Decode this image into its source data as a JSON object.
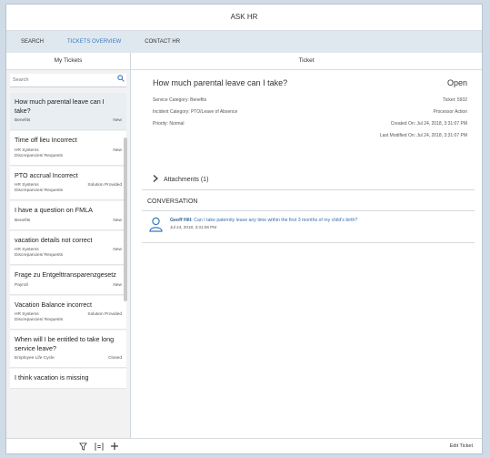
{
  "app": {
    "title": "ASK HR"
  },
  "tabs": [
    {
      "label": "SEARCH"
    },
    {
      "label": "TICKETS OVERVIEW"
    },
    {
      "label": "CONTACT HR"
    }
  ],
  "left": {
    "header": "My Tickets",
    "search_placeholder": "Search",
    "items": [
      {
        "title": "How much parental leave can I take?",
        "category": "Benefits",
        "status": "New"
      },
      {
        "title": "Time off lieu Incorrect",
        "category": "HR Systems Discrepancies/ Requests",
        "status": "New"
      },
      {
        "title": "PTO accrual Incorrect",
        "category": "HR Systems Discrepancies/ Requests",
        "status": "Solution Provided"
      },
      {
        "title": "I have a question on FMLA",
        "category": "Benefits",
        "status": "New"
      },
      {
        "title": "vacation details not correct",
        "category": "HR Systems Discrepancies/ Requests",
        "status": "New"
      },
      {
        "title": "Frage zu Entgelttransparenzgesetz",
        "category": "Payroll",
        "status": "New"
      },
      {
        "title": "Vacation Balance incorrect",
        "category": "HR Systems Discrepancies/ Requests",
        "status": "Solution Provided"
      },
      {
        "title": "When will I be entitled to take long service leave?",
        "category": "Employee Life Cycle",
        "status": "Closed"
      },
      {
        "title": "I think vacation is missing",
        "category": "",
        "status": ""
      }
    ]
  },
  "ticket": {
    "header": "Ticket",
    "title": "How much parental leave can I take?",
    "status": "Open",
    "service_category": "Service Category: Benefits",
    "incident_category": "Incident Category: PTO/Leave of Absence",
    "priority": "Priority: Normal",
    "ticket_no": "Ticket: 5932",
    "processor_action": "Processor Action",
    "created_on": "Created On: Jul 24, 2018, 3:31:07 PM",
    "modified_on": "Last Modified On: Jul 24, 2018, 3:31:07 PM",
    "attachments": "Attachments (1)",
    "conversation_header": "CONVERSATION",
    "message": {
      "author": "Geoff Hill:",
      "text": "Can I take paternity leave any time within the first 3 months of my child's birth?",
      "date": "Jul 24, 2018, 3:31:06 PM"
    }
  },
  "footer": {
    "edit": "Edit Ticket"
  }
}
